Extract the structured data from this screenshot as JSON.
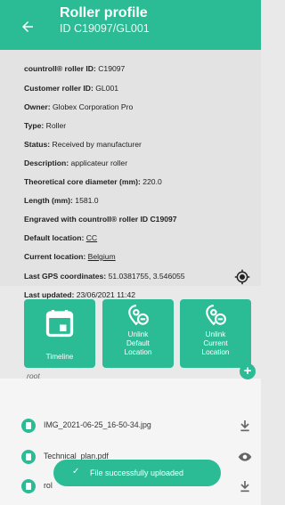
{
  "header": {
    "title": "Roller profile",
    "subtitle": "ID C19097/GL001"
  },
  "details": [
    {
      "label": "countroll® roller ID:",
      "value": "C19097"
    },
    {
      "label": "Customer roller ID:",
      "value": "GL001"
    },
    {
      "label": "Owner:",
      "value": "Globex Corporation Pro"
    },
    {
      "label": "Type:",
      "value": "Roller"
    },
    {
      "label": "Status:",
      "value": "Received by manufacturer"
    },
    {
      "label": "Description:",
      "value": "applicateur roller"
    },
    {
      "label": "Theoretical core diameter (mm):",
      "value": "220.0"
    },
    {
      "label": "Length (mm):",
      "value": "1581.0"
    },
    {
      "label": "Engraved with countroll® roller ID C19097",
      "value": ""
    },
    {
      "label": "Default location:",
      "value": "CC"
    },
    {
      "label": "Current location:",
      "value": "Belgium"
    },
    {
      "label": "Last GPS coordinates:",
      "value": "51.0381755, 3.546055"
    },
    {
      "label": "Last updated:",
      "value": "23/06/2021 11:42"
    }
  ],
  "actions": {
    "timeline": "Timeline",
    "unlink_default": [
      "Unlink",
      "Default",
      "Location"
    ],
    "unlink_current": [
      "Unlink",
      "Current",
      "Location"
    ]
  },
  "files": {
    "root_label": "root",
    "items": [
      {
        "name": "IMG_2021-06-25_16-50-34.jpg",
        "action_icon": "download-icon"
      },
      {
        "name": "Technical_plan.pdf",
        "action_icon": "eye-icon"
      },
      {
        "name": "rol",
        "action_icon": "download-icon"
      }
    ]
  },
  "toast": {
    "text": "File successfully uploaded"
  },
  "colors": {
    "accent": "#2bbc96"
  }
}
